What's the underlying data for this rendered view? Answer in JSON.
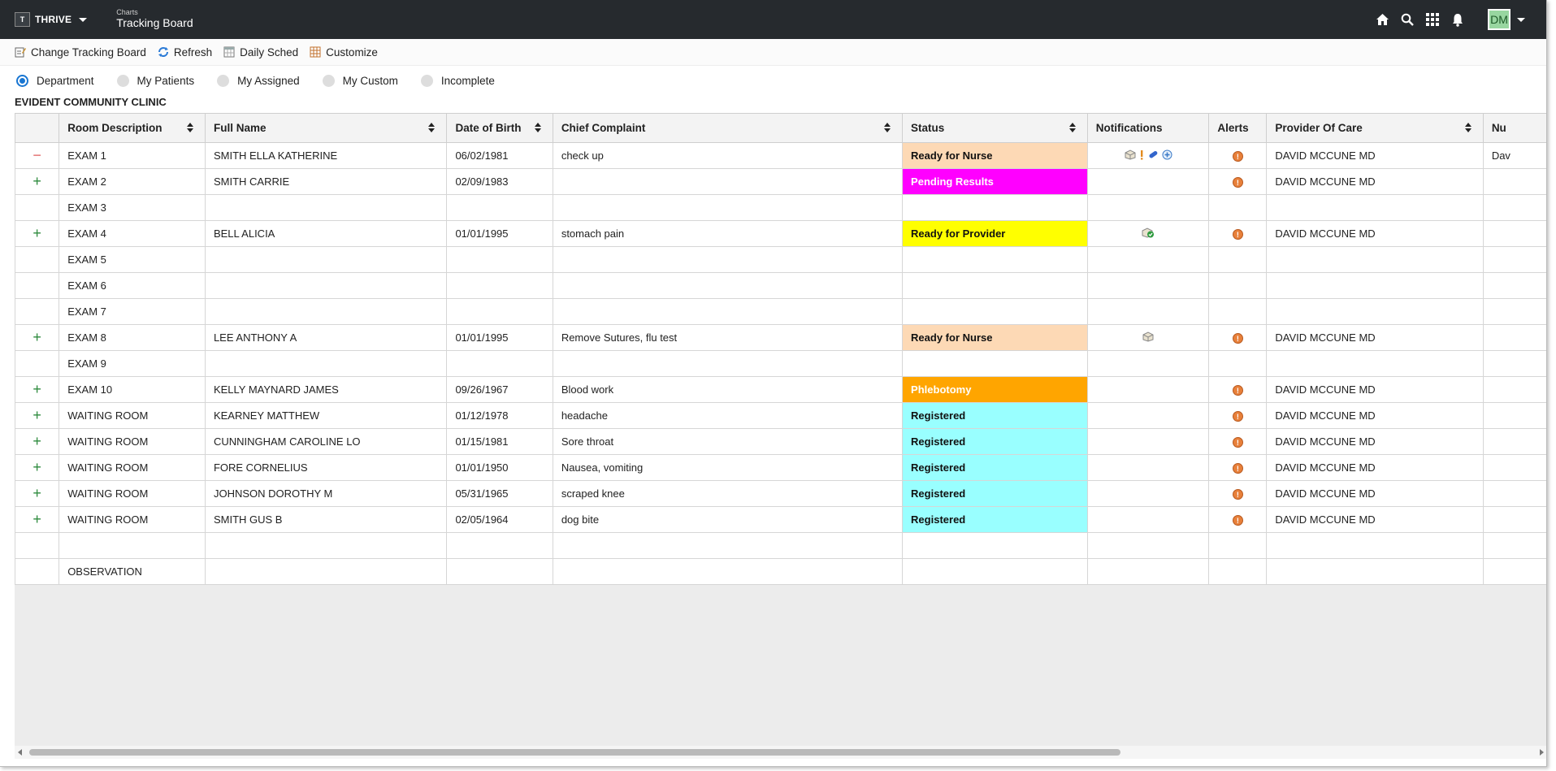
{
  "app": {
    "brand": "THRIVE",
    "title_sub": "Charts",
    "title_main": "Tracking Board",
    "avatar": "DM"
  },
  "toolbar": {
    "change": "Change Tracking Board",
    "refresh": "Refresh",
    "daily": "Daily Sched",
    "customize": "Customize"
  },
  "filters": [
    {
      "label": "Department",
      "selected": true
    },
    {
      "label": "My Patients",
      "selected": false
    },
    {
      "label": "My Assigned",
      "selected": false
    },
    {
      "label": "My Custom",
      "selected": false
    },
    {
      "label": "Incomplete",
      "selected": false
    }
  ],
  "clinic": "EVIDENT COMMUNITY CLINIC",
  "columns": [
    "Room Description",
    "Full Name",
    "Date of Birth",
    "Chief Complaint",
    "Status",
    "Notifications",
    "Alerts",
    "Provider Of Care",
    "Nu"
  ],
  "status_colors": {
    "Ready for Nurse": {
      "bg": "#fdd9b5",
      "fg": "#111111"
    },
    "Pending Results": {
      "bg": "#ff00ff",
      "fg": "#ffffff"
    },
    "Ready for Provider": {
      "bg": "#ffff00",
      "fg": "#111111"
    },
    "Phlebotomy": {
      "bg": "#ffa500",
      "fg": "#ffffff"
    },
    "Registered": {
      "bg": "#99ffff",
      "fg": "#111111"
    }
  },
  "rows": [
    {
      "expander": "minus",
      "room": "EXAM 1",
      "name": "SMITH ELLA KATHERINE",
      "dob": "06/02/1981",
      "complaint": "check up",
      "status": "Ready for Nurse",
      "notifications": [
        "box-icon",
        "exclaim-icon",
        "pill-icon",
        "plus-circle-icon"
      ],
      "alert": true,
      "provider": "DAVID MCCUNE MD",
      "nu": "Dav"
    },
    {
      "expander": "plus",
      "room": "EXAM 2",
      "name": "SMITH CARRIE",
      "dob": "02/09/1983",
      "complaint": "",
      "status": "Pending Results",
      "notifications": [],
      "alert": true,
      "provider": "DAVID MCCUNE MD",
      "nu": ""
    },
    {
      "expander": "",
      "room": "EXAM 3",
      "name": "",
      "dob": "",
      "complaint": "",
      "status": "",
      "notifications": [],
      "alert": false,
      "provider": "",
      "nu": ""
    },
    {
      "expander": "plus",
      "room": "EXAM 4",
      "name": "BELL ALICIA",
      "dob": "01/01/1995",
      "complaint": "stomach pain",
      "status": "Ready for Provider",
      "notifications": [
        "check-box-icon"
      ],
      "alert": true,
      "provider": "DAVID MCCUNE MD",
      "nu": ""
    },
    {
      "expander": "",
      "room": "EXAM 5",
      "name": "",
      "dob": "",
      "complaint": "",
      "status": "",
      "notifications": [],
      "alert": false,
      "provider": "",
      "nu": ""
    },
    {
      "expander": "",
      "room": "EXAM 6",
      "name": "",
      "dob": "",
      "complaint": "",
      "status": "",
      "notifications": [],
      "alert": false,
      "provider": "",
      "nu": ""
    },
    {
      "expander": "",
      "room": "EXAM 7",
      "name": "",
      "dob": "",
      "complaint": "",
      "status": "",
      "notifications": [],
      "alert": false,
      "provider": "",
      "nu": ""
    },
    {
      "expander": "plus",
      "room": "EXAM 8",
      "name": "LEE ANTHONY A",
      "dob": "01/01/1995",
      "complaint": "Remove Sutures, flu test",
      "status": "Ready for Nurse",
      "notifications": [
        "box-icon"
      ],
      "alert": true,
      "provider": "DAVID MCCUNE MD",
      "nu": ""
    },
    {
      "expander": "",
      "room": "EXAM 9",
      "name": "",
      "dob": "",
      "complaint": "",
      "status": "",
      "notifications": [],
      "alert": false,
      "provider": "",
      "nu": ""
    },
    {
      "expander": "plus",
      "room": "EXAM 10",
      "name": "KELLY MAYNARD JAMES",
      "dob": "09/26/1967",
      "complaint": "Blood work",
      "status": "Phlebotomy",
      "notifications": [],
      "alert": true,
      "provider": "DAVID MCCUNE MD",
      "nu": ""
    },
    {
      "expander": "plus",
      "room": "WAITING ROOM",
      "name": "KEARNEY MATTHEW",
      "dob": "01/12/1978",
      "complaint": "headache",
      "status": "Registered",
      "notifications": [],
      "alert": true,
      "provider": "DAVID MCCUNE MD",
      "nu": ""
    },
    {
      "expander": "plus",
      "room": "WAITING ROOM",
      "name": "CUNNINGHAM CAROLINE LO",
      "dob": "01/15/1981",
      "complaint": "Sore throat",
      "status": "Registered",
      "notifications": [],
      "alert": true,
      "provider": "DAVID MCCUNE MD",
      "nu": ""
    },
    {
      "expander": "plus",
      "room": "WAITING ROOM",
      "name": "FORE CORNELIUS",
      "dob": "01/01/1950",
      "complaint": "Nausea, vomiting",
      "status": "Registered",
      "notifications": [],
      "alert": true,
      "provider": "DAVID MCCUNE MD",
      "nu": ""
    },
    {
      "expander": "plus",
      "room": "WAITING ROOM",
      "name": "JOHNSON DOROTHY M",
      "dob": "05/31/1965",
      "complaint": "scraped knee",
      "status": "Registered",
      "notifications": [],
      "alert": true,
      "provider": "DAVID MCCUNE MD",
      "nu": ""
    },
    {
      "expander": "plus",
      "room": "WAITING ROOM",
      "name": "SMITH GUS B",
      "dob": "02/05/1964",
      "complaint": "dog bite",
      "status": "Registered",
      "notifications": [],
      "alert": true,
      "provider": "DAVID MCCUNE MD",
      "nu": ""
    },
    {
      "expander": "",
      "room": "",
      "name": "",
      "dob": "",
      "complaint": "",
      "status": "",
      "notifications": [],
      "alert": false,
      "provider": "",
      "nu": ""
    },
    {
      "expander": "",
      "room": "OBSERVATION",
      "name": "",
      "dob": "",
      "complaint": "",
      "status": "",
      "notifications": [],
      "alert": false,
      "provider": "",
      "nu": ""
    }
  ]
}
